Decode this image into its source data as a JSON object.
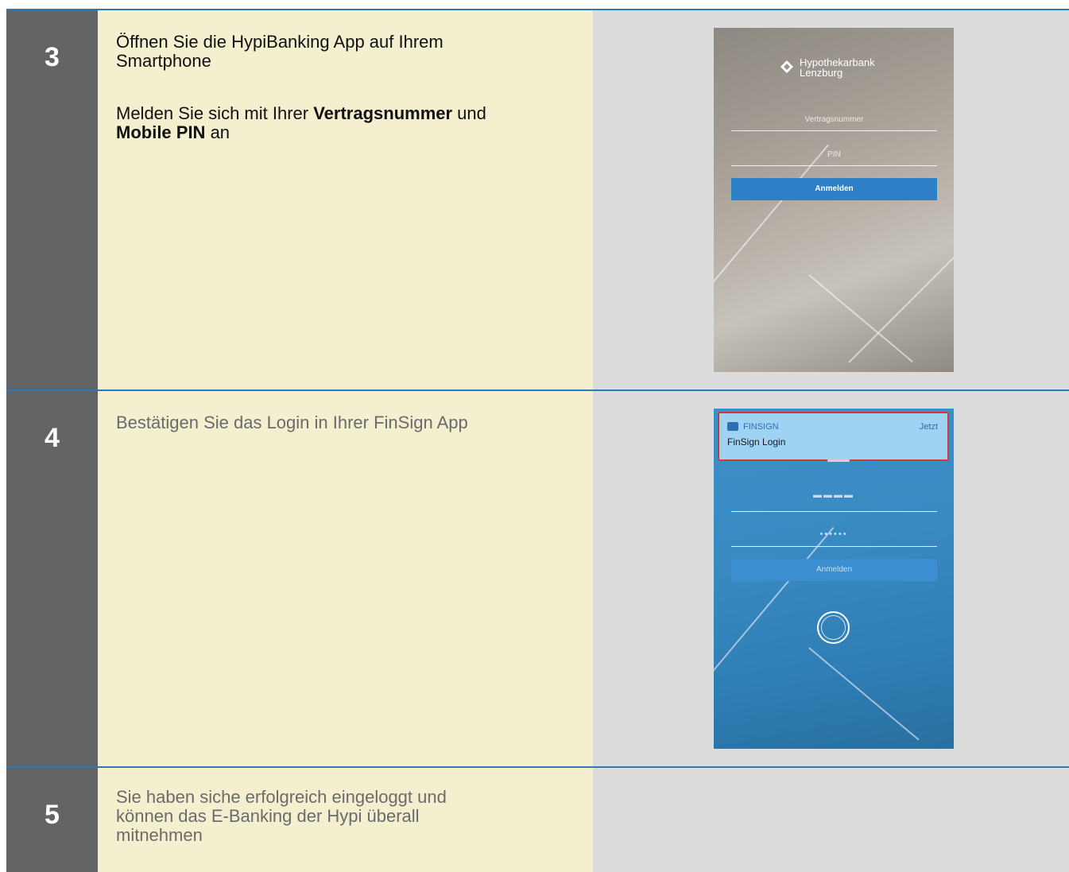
{
  "steps": [
    {
      "number": "3",
      "line1": "Öffnen Sie die HypiBanking App auf Ihrem",
      "line2": "Smartphone",
      "p2_pre": "Melden Sie sich mit Ihrer ",
      "p2_bold1": "Vertragsnummer",
      "p2_mid": " und",
      "p2_bold2": "Mobile PIN",
      "p2_post": " an"
    },
    {
      "number": "4",
      "line1": "Bestätigen Sie das Login in Ihrer FinSign App"
    },
    {
      "number": "5",
      "line1": "Sie haben siche erfolgreich eingeloggt und",
      "line2": "können das E-Banking der Hypi überall",
      "line3": "mitnehmen"
    }
  ],
  "phone1": {
    "logo_line1": "Hypothekarbank",
    "logo_line2": "Lenzburg",
    "contract_placeholder": "Vertragsnummer",
    "pin_placeholder": "PIN",
    "login_label": "Anmelden"
  },
  "phone2": {
    "notif_app": "FINSIGN",
    "notif_time": "Jetzt",
    "notif_title": "FinSign Login",
    "contract_masked": "▬▬▬▬",
    "pin_masked": "••••••",
    "login_label": "Anmelden"
  },
  "colors": {
    "number_column": "#636466",
    "text_column": "#f3efcf",
    "image_column": "#dcdcdc",
    "divider": "#2d79b4",
    "login_button": "#2d7fc6",
    "notification_border": "#d23a3a"
  }
}
